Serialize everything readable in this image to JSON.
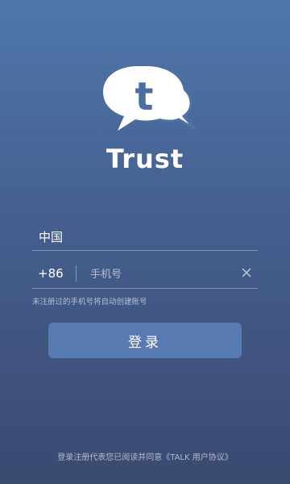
{
  "brand": {
    "name": "Trust",
    "logo_letter": "t",
    "logo_icon": "chat-bubble-logo"
  },
  "form": {
    "country_label": "中国",
    "country_code": "+86",
    "phone_placeholder": "手机号",
    "phone_value": "",
    "clear_icon": "close-icon",
    "hint": "未注册过的手机号将自动创建账号"
  },
  "login_button": {
    "label": "登录"
  },
  "agreement": {
    "text": "登录注册代表您已阅读并同意《TALK 用户协议》"
  },
  "colors": {
    "bg_top": "#4f77ab",
    "bg_bottom": "#3a4a70",
    "button": "#587ab2",
    "logo_letter": "#4a6ea4"
  }
}
